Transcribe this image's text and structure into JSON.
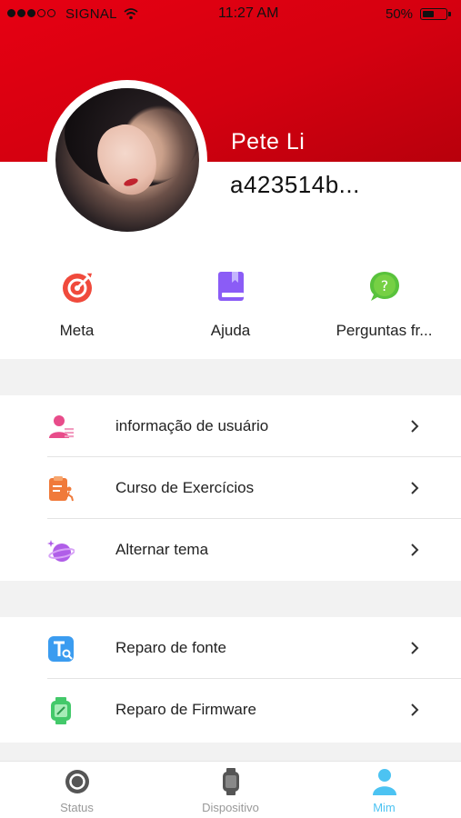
{
  "status_bar": {
    "carrier": "SIGNAL",
    "time": "11:27 AM",
    "battery": "50%"
  },
  "profile": {
    "name": "Pete Li",
    "user_id": "a423514b..."
  },
  "quick_actions": [
    {
      "label": "Meta",
      "icon": "target-icon",
      "color": "#f04a3c"
    },
    {
      "label": "Ajuda",
      "icon": "book-icon",
      "color": "#8b5cf6"
    },
    {
      "label": "Perguntas fr...",
      "icon": "question-bubble-icon",
      "color": "#59c23c"
    }
  ],
  "settings_group_1": [
    {
      "label": "informação de usuário",
      "icon": "user-info-icon"
    },
    {
      "label": "Curso de Exercícios",
      "icon": "exercise-clipboard-icon"
    },
    {
      "label": "Alternar tema",
      "icon": "planet-theme-icon"
    }
  ],
  "settings_group_2": [
    {
      "label": "Reparo de fonte",
      "icon": "font-repair-icon"
    },
    {
      "label": "Reparo de Firmware",
      "icon": "firmware-watch-icon"
    }
  ],
  "tabs": [
    {
      "label": "Status",
      "icon": "status-ring-icon"
    },
    {
      "label": "Dispositivo",
      "icon": "watch-icon"
    },
    {
      "label": "Mim",
      "icon": "person-icon",
      "active": true
    }
  ],
  "colors": {
    "header_red": "#e60012",
    "active_tab": "#4cc3f2"
  }
}
